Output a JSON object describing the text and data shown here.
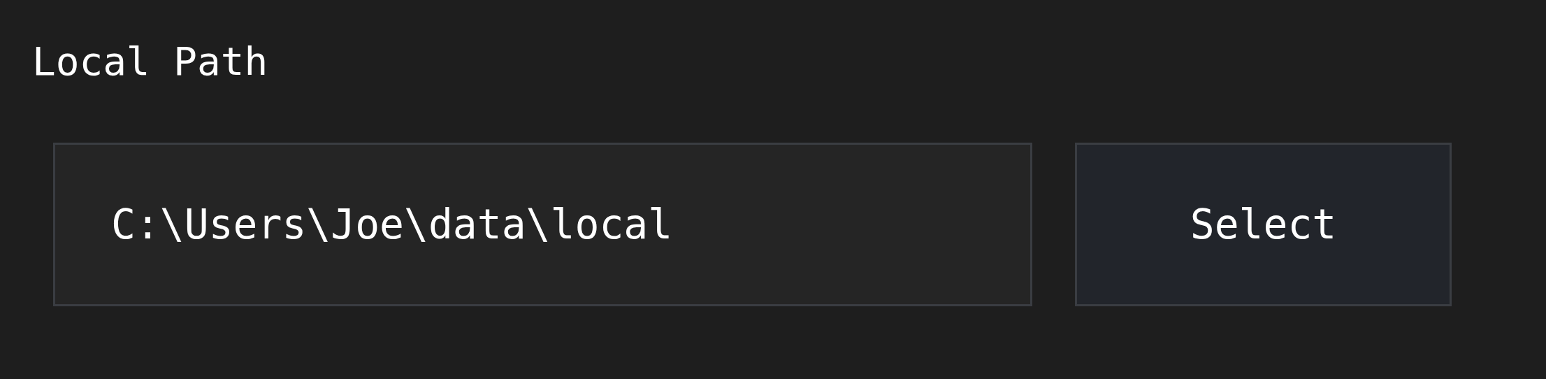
{
  "label": "Local Path",
  "path_field": {
    "value": "C:\\Users\\Joe\\data\\local"
  },
  "button": {
    "label": "Select"
  }
}
